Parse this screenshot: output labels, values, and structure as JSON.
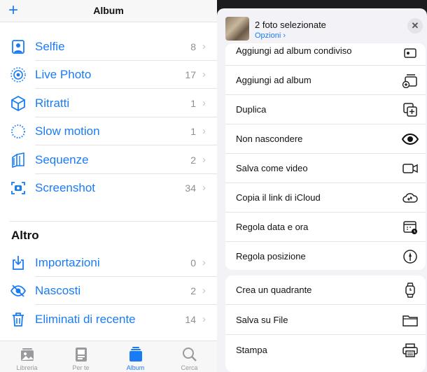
{
  "left": {
    "title": "Album",
    "plus": "+",
    "media_types": [
      {
        "label": "Selfie",
        "count": "8",
        "icon": "selfie-icon"
      },
      {
        "label": "Live Photo",
        "count": "17",
        "icon": "live-photo-icon"
      },
      {
        "label": "Ritratti",
        "count": "1",
        "icon": "portrait-icon"
      },
      {
        "label": "Slow motion",
        "count": "1",
        "icon": "slow-motion-icon"
      },
      {
        "label": "Sequenze",
        "count": "2",
        "icon": "burst-icon"
      },
      {
        "label": "Screenshot",
        "count": "34",
        "icon": "screenshot-icon"
      }
    ],
    "other_title": "Altro",
    "other": [
      {
        "label": "Importazioni",
        "count": "0",
        "icon": "import-icon"
      },
      {
        "label": "Nascosti",
        "count": "2",
        "icon": "hidden-icon"
      },
      {
        "label": "Eliminati di recente",
        "count": "14",
        "icon": "trash-icon"
      }
    ],
    "tabs": [
      {
        "label": "Libreria",
        "icon": "library-icon"
      },
      {
        "label": "Per te",
        "icon": "for-you-icon"
      },
      {
        "label": "Album",
        "icon": "albums-icon",
        "active": true
      },
      {
        "label": "Cerca",
        "icon": "search-icon"
      }
    ]
  },
  "sheet": {
    "title": "2 foto selezionate",
    "options": "Opzioni ›",
    "close": "✕",
    "group1": [
      {
        "label": "Aggiungi ad album condiviso",
        "icon": "shared-album-icon"
      },
      {
        "label": "Aggiungi ad album",
        "icon": "add-album-icon"
      },
      {
        "label": "Duplica",
        "icon": "duplicate-icon"
      },
      {
        "label": "Non nascondere",
        "icon": "eye-icon"
      },
      {
        "label": "Salva come video",
        "icon": "video-icon"
      },
      {
        "label": "Copia il link di iCloud",
        "icon": "icloud-link-icon"
      },
      {
        "label": "Regola data e ora",
        "icon": "calendar-icon"
      },
      {
        "label": "Regola posizione",
        "icon": "location-icon"
      }
    ],
    "group2": [
      {
        "label": "Crea un quadrante",
        "icon": "watch-icon"
      },
      {
        "label": "Salva su File",
        "icon": "folder-icon"
      },
      {
        "label": "Stampa",
        "icon": "print-icon"
      }
    ]
  },
  "colors": {
    "accent": "#1a7cf5",
    "secondary": "#8e8e93"
  }
}
